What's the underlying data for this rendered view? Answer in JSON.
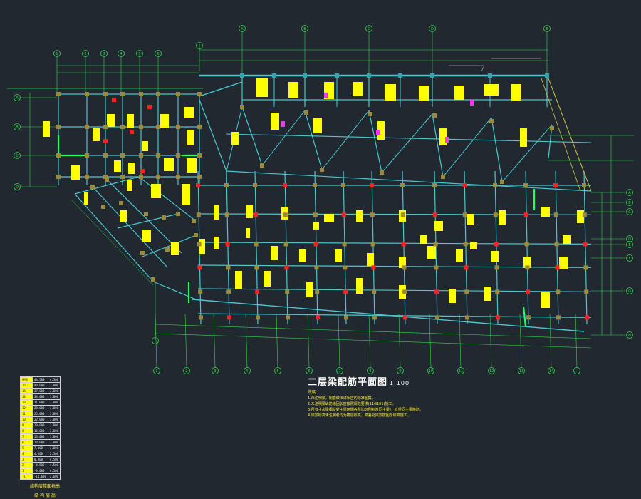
{
  "drawing": {
    "title": "二层梁配筋平面图",
    "scale": "1:100",
    "notes_heading": "说明：",
    "notes": [
      "1.未注明梁，钢筋做法详相应的标准图集。",
      "2.未注明梁纵筋锚固长度按照规范要求(11G101)施工。",
      "3.所有主次梁相交处主梁两侧各附加3组箍筋(同主梁)，直径同主梁箍筋。",
      "4.梁顶标高未注明者均为楼层标高，高差处梁顶按图示标高施工。"
    ],
    "table_caption": "结构层楼面标高",
    "table_caption_2": "结 构 层 高"
  },
  "floor_table": {
    "rows": [
      [
        "屋面",
        "44.500",
        "4.500"
      ],
      [
        "16",
        "40.000",
        "3.000"
      ],
      [
        "15",
        "37.000",
        "3.000"
      ],
      [
        "14",
        "34.000",
        "3.000"
      ],
      [
        "13",
        "31.000",
        "3.000"
      ],
      [
        "12",
        "28.000",
        "3.000"
      ],
      [
        "11",
        "25.000",
        "3.000"
      ],
      [
        "10",
        "22.000",
        "3.000"
      ],
      [
        "9",
        "19.000",
        "3.000"
      ],
      [
        "8",
        "16.000",
        "3.000"
      ],
      [
        "7",
        "13.000",
        "3.000"
      ],
      [
        "6",
        "10.000",
        "3.000"
      ],
      [
        "5",
        "7.000",
        "3.000"
      ],
      [
        "4",
        "4.500",
        "2.500"
      ],
      [
        "3",
        "0.000",
        "4.500"
      ],
      [
        "2",
        "-4.500",
        "4.500"
      ],
      [
        "1",
        "-9.000",
        "4.500"
      ],
      [
        "-1",
        "-11.600",
        "2.600"
      ]
    ]
  },
  "axes": {
    "top": [
      "A",
      "B",
      "C",
      "D",
      "E"
    ],
    "top_left": [
      "1",
      "2",
      "3",
      "4",
      "5",
      "6"
    ],
    "bottom": [
      "1",
      "2",
      "3",
      "4",
      "5",
      "6",
      "7",
      "8",
      "9",
      "10",
      "11",
      "12",
      "13",
      "14"
    ],
    "left": [
      "A",
      "B",
      "C",
      "D"
    ],
    "right": [
      "A",
      "B",
      "C",
      "D",
      "E",
      "F",
      "G",
      "H",
      "J"
    ]
  },
  "colors": {
    "background": "#212830",
    "beam": "#48c8cf",
    "grid_axis": "#2fd94a",
    "column": "#9a8a3a",
    "red_mark": "#ff2020",
    "annotation": "#ffff00",
    "magenta_mark": "#ff33ff",
    "bright_green_beam": "#22ff66"
  }
}
